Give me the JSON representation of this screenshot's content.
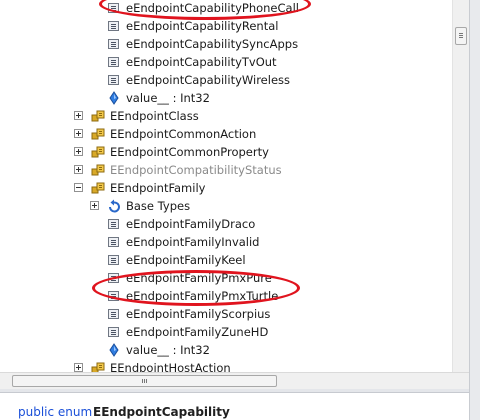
{
  "tree": {
    "rows": [
      {
        "type": "field",
        "label": "eEndpointCapabilityPhoneCall",
        "dim": false,
        "level": 2
      },
      {
        "type": "field",
        "label": "eEndpointCapabilityRental",
        "dim": false,
        "level": 2
      },
      {
        "type": "field",
        "label": "eEndpointCapabilitySyncApps",
        "dim": false,
        "level": 2
      },
      {
        "type": "field",
        "label": "eEndpointCapabilityTvOut",
        "dim": false,
        "level": 2
      },
      {
        "type": "field",
        "label": "eEndpointCapabilityWireless",
        "dim": false,
        "level": 2
      },
      {
        "type": "value",
        "label": "value__ : Int32",
        "dim": false,
        "level": 2
      },
      {
        "type": "enum",
        "label": "EEndpointClass",
        "dim": false,
        "level": 1,
        "expander": "plus"
      },
      {
        "type": "enum",
        "label": "EEndpointCommonAction",
        "dim": false,
        "level": 1,
        "expander": "plus"
      },
      {
        "type": "enum",
        "label": "EEndpointCommonProperty",
        "dim": false,
        "level": 1,
        "expander": "plus"
      },
      {
        "type": "enum",
        "label": "EEndpointCompatibilityStatus",
        "dim": true,
        "level": 1,
        "expander": "plus"
      },
      {
        "type": "enum",
        "label": "EEndpointFamily",
        "dim": false,
        "level": 1,
        "expander": "minus"
      },
      {
        "type": "basetypes",
        "label": "Base Types",
        "dim": false,
        "level": 2,
        "expander": "plus"
      },
      {
        "type": "field",
        "label": "eEndpointFamilyDraco",
        "dim": false,
        "level": 2
      },
      {
        "type": "field",
        "label": "eEndpointFamilyInvalid",
        "dim": false,
        "level": 2
      },
      {
        "type": "field",
        "label": "eEndpointFamilyKeel",
        "dim": false,
        "level": 2
      },
      {
        "type": "field",
        "label": "eEndpointFamilyPmxPure",
        "dim": false,
        "level": 2
      },
      {
        "type": "field",
        "label": "eEndpointFamilyPmxTurtle",
        "dim": false,
        "level": 2
      },
      {
        "type": "field",
        "label": "eEndpointFamilyScorpius",
        "dim": false,
        "level": 2
      },
      {
        "type": "field",
        "label": "eEndpointFamilyZuneHD",
        "dim": false,
        "level": 2
      },
      {
        "type": "value",
        "label": "value__ : Int32",
        "dim": false,
        "level": 2
      },
      {
        "type": "enum",
        "label": "EEndpointHostAction",
        "dim": false,
        "level": 1,
        "expander": "plus"
      }
    ]
  },
  "status": {
    "keyword": "public enum",
    "type_name": "EEndpointCapability"
  },
  "colors": {
    "highlight_ring": "#e0141e",
    "keyword": "#1a4fd8",
    "dimmed_text": "#8a8a8a"
  }
}
